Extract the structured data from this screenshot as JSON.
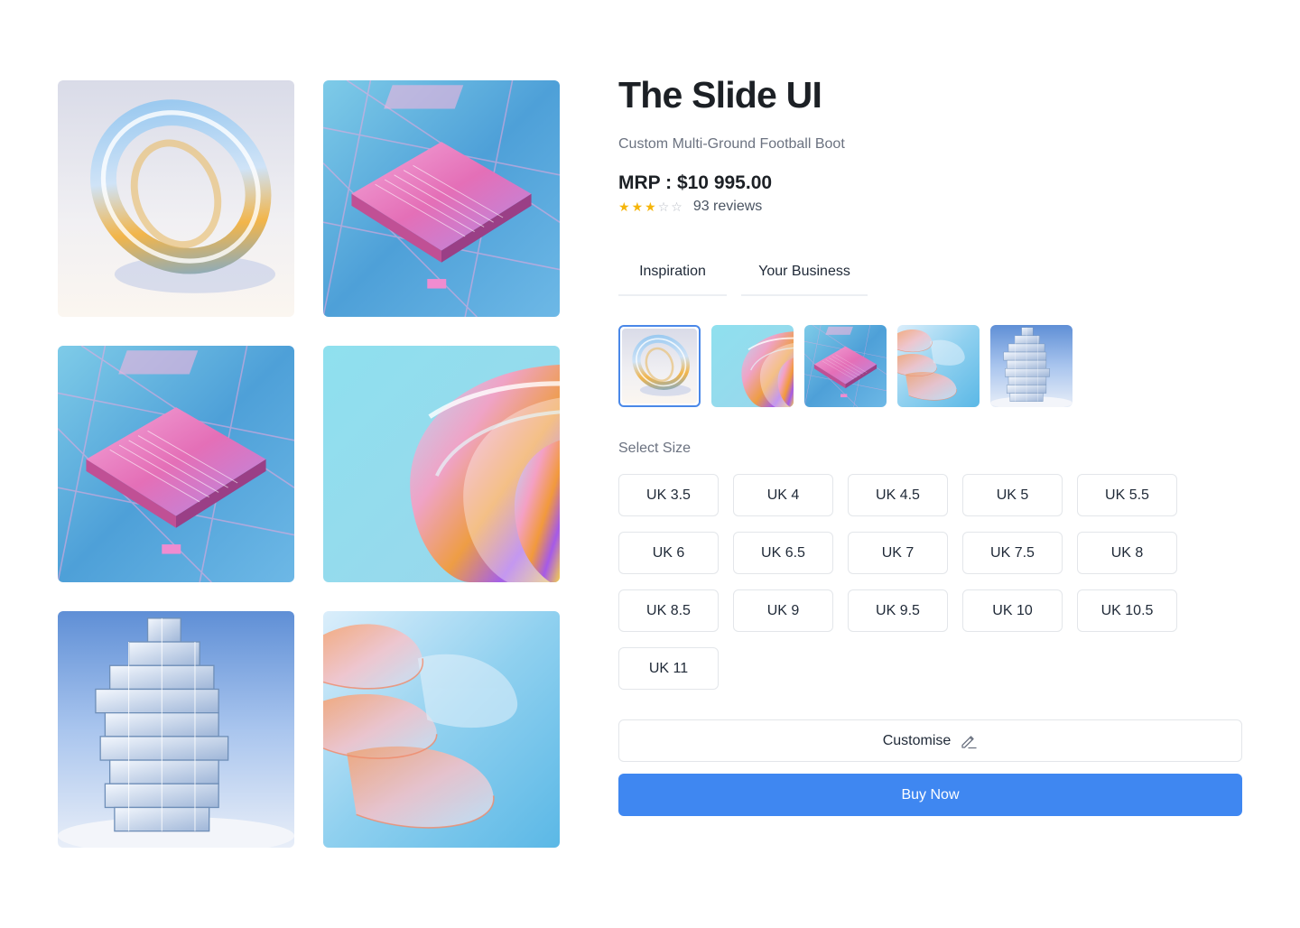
{
  "product": {
    "title": "The Slide UI",
    "subtitle": "Custom Multi-Ground Football Boot",
    "price": "MRP : $10 995.00",
    "rating": 3,
    "rating_max": 5,
    "reviews": "93 reviews"
  },
  "gallery": {
    "images": [
      {
        "icon": "glass-ring-image"
      },
      {
        "icon": "chip-pink-image"
      },
      {
        "icon": "chip-blue-image"
      },
      {
        "icon": "iridescent-swirl-image"
      },
      {
        "icon": "glass-blocks-image"
      },
      {
        "icon": "glass-sheets-image"
      }
    ]
  },
  "tabs": [
    {
      "label": "Inspiration"
    },
    {
      "label": "Your Business"
    }
  ],
  "thumbnails": {
    "selected_index": 0,
    "items": [
      {
        "icon": "glass-ring-thumb"
      },
      {
        "icon": "iridescent-swirl-thumb"
      },
      {
        "icon": "chip-thumb"
      },
      {
        "icon": "glass-sheets-thumb"
      },
      {
        "icon": "glass-blocks-thumb"
      }
    ]
  },
  "sizes": {
    "label": "Select Size",
    "options": [
      "UK 3.5",
      "UK 4",
      "UK 4.5",
      "UK 5",
      "UK 5.5",
      "UK 6",
      "UK 6.5",
      "UK 7",
      "UK 7.5",
      "UK 8",
      "UK 8.5",
      "UK 9",
      "UK 9.5",
      "UK 10",
      "UK 10.5",
      "UK 11"
    ]
  },
  "actions": {
    "customise_label": "Customise",
    "customise_icon": "pencil-icon",
    "buy_label": "Buy Now"
  },
  "colors": {
    "accent": "#3f87f1",
    "star": "#f5b50a",
    "selected_border": "#4a88e8"
  }
}
